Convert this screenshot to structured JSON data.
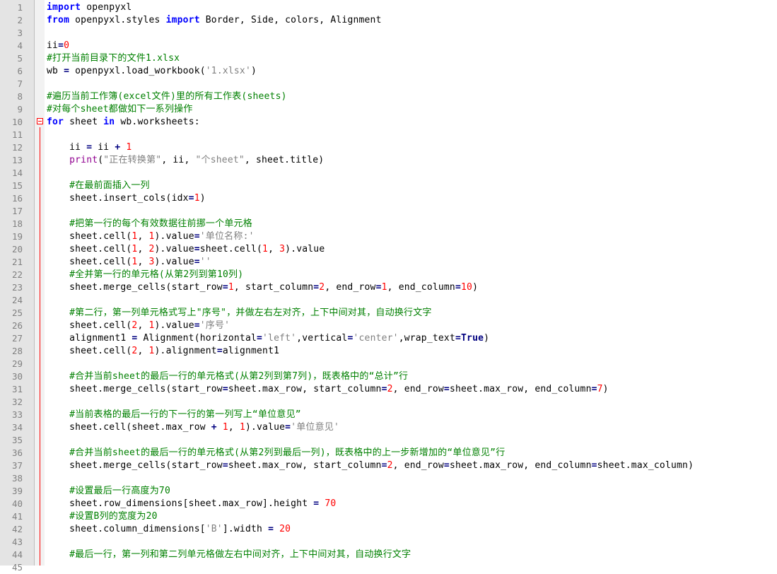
{
  "editor": {
    "language": "python",
    "syntax_colors": {
      "keyword": "#0000ff",
      "number": "#ff0000",
      "string": "#808080",
      "comment": "#008000",
      "builtin": "#900090",
      "operator": "#000080",
      "fold_marker": "#ff0000",
      "gutter_background": "#e4e4e4"
    },
    "fold_open_icon": "minus-box-icon",
    "lines": [
      {
        "n": "1",
        "tokens": [
          [
            "kw",
            "import"
          ],
          [
            "t",
            " openpyxl"
          ]
        ]
      },
      {
        "n": "2",
        "tokens": [
          [
            "kw",
            "from"
          ],
          [
            "t",
            " openpyxl.styles "
          ],
          [
            "kw",
            "import"
          ],
          [
            "t",
            " Border, Side, colors, Alignment"
          ]
        ]
      },
      {
        "n": "3",
        "tokens": []
      },
      {
        "n": "4",
        "tokens": [
          [
            "t",
            "ii"
          ],
          [
            "op",
            "="
          ],
          [
            "num",
            "0"
          ]
        ]
      },
      {
        "n": "5",
        "tokens": [
          [
            "cm",
            "#打开当前目录下的文件1.xlsx"
          ]
        ]
      },
      {
        "n": "6",
        "tokens": [
          [
            "t",
            "wb "
          ],
          [
            "op",
            "="
          ],
          [
            "t",
            " openpyxl.load_workbook("
          ],
          [
            "str",
            "'1.xlsx'"
          ],
          [
            "t",
            ")"
          ]
        ]
      },
      {
        "n": "7",
        "tokens": []
      },
      {
        "n": "8",
        "tokens": [
          [
            "cm",
            "#遍历当前工作簿(excel文件)里的所有工作表(sheets)"
          ]
        ]
      },
      {
        "n": "9",
        "tokens": [
          [
            "cm",
            "#对每个sheet都做如下一系列操作"
          ]
        ]
      },
      {
        "n": "10",
        "tokens": [
          [
            "kw",
            "for"
          ],
          [
            "t",
            " sheet "
          ],
          [
            "kw",
            "in"
          ],
          [
            "t",
            " wb.worksheets:"
          ]
        ]
      },
      {
        "n": "11",
        "tokens": []
      },
      {
        "n": "12",
        "tokens": [
          [
            "t",
            "    ii "
          ],
          [
            "op",
            "="
          ],
          [
            "t",
            " ii "
          ],
          [
            "op",
            "+"
          ],
          [
            "t",
            " "
          ],
          [
            "num",
            "1"
          ]
        ]
      },
      {
        "n": "13",
        "tokens": [
          [
            "t",
            "    "
          ],
          [
            "bi",
            "print"
          ],
          [
            "t",
            "("
          ],
          [
            "str",
            "\"正在转换第\""
          ],
          [
            "t",
            ", ii, "
          ],
          [
            "str",
            "\"个sheet\""
          ],
          [
            "t",
            ", sheet.title)"
          ]
        ]
      },
      {
        "n": "14",
        "tokens": []
      },
      {
        "n": "15",
        "tokens": [
          [
            "t",
            "    "
          ],
          [
            "cm",
            "#在最前面插入一列"
          ]
        ]
      },
      {
        "n": "16",
        "tokens": [
          [
            "t",
            "    sheet.insert_cols(idx"
          ],
          [
            "op",
            "="
          ],
          [
            "num",
            "1"
          ],
          [
            "t",
            ")"
          ]
        ]
      },
      {
        "n": "17",
        "tokens": []
      },
      {
        "n": "18",
        "tokens": [
          [
            "t",
            "    "
          ],
          [
            "cm",
            "#把第一行的每个有效数据往前挪一个单元格"
          ]
        ]
      },
      {
        "n": "19",
        "tokens": [
          [
            "t",
            "    sheet.cell("
          ],
          [
            "num",
            "1"
          ],
          [
            "t",
            ", "
          ],
          [
            "num",
            "1"
          ],
          [
            "t",
            ").value"
          ],
          [
            "op",
            "="
          ],
          [
            "str",
            "'单位名称:'"
          ]
        ]
      },
      {
        "n": "20",
        "tokens": [
          [
            "t",
            "    sheet.cell("
          ],
          [
            "num",
            "1"
          ],
          [
            "t",
            ", "
          ],
          [
            "num",
            "2"
          ],
          [
            "t",
            ").value"
          ],
          [
            "op",
            "="
          ],
          [
            "t",
            "sheet.cell("
          ],
          [
            "num",
            "1"
          ],
          [
            "t",
            ", "
          ],
          [
            "num",
            "3"
          ],
          [
            "t",
            ").value"
          ]
        ]
      },
      {
        "n": "21",
        "tokens": [
          [
            "t",
            "    sheet.cell("
          ],
          [
            "num",
            "1"
          ],
          [
            "t",
            ", "
          ],
          [
            "num",
            "3"
          ],
          [
            "t",
            ").value"
          ],
          [
            "op",
            "="
          ],
          [
            "str",
            "''"
          ]
        ]
      },
      {
        "n": "22",
        "tokens": [
          [
            "t",
            "    "
          ],
          [
            "cm",
            "#全并第一行的单元格(从第2列到第10列)"
          ]
        ]
      },
      {
        "n": "23",
        "tokens": [
          [
            "t",
            "    sheet.merge_cells(start_row"
          ],
          [
            "op",
            "="
          ],
          [
            "num",
            "1"
          ],
          [
            "t",
            ", start_column"
          ],
          [
            "op",
            "="
          ],
          [
            "num",
            "2"
          ],
          [
            "t",
            ", end_row"
          ],
          [
            "op",
            "="
          ],
          [
            "num",
            "1"
          ],
          [
            "t",
            ", end_column"
          ],
          [
            "op",
            "="
          ],
          [
            "num",
            "10"
          ],
          [
            "t",
            ")"
          ]
        ]
      },
      {
        "n": "24",
        "tokens": []
      },
      {
        "n": "25",
        "tokens": [
          [
            "t",
            "    "
          ],
          [
            "cm",
            "#第二行，第一列单元格式写上\"序号\"，并做左右左对齐，上下中间对其，自动换行文字"
          ]
        ]
      },
      {
        "n": "26",
        "tokens": [
          [
            "t",
            "    sheet.cell("
          ],
          [
            "num",
            "2"
          ],
          [
            "t",
            ", "
          ],
          [
            "num",
            "1"
          ],
          [
            "t",
            ").value"
          ],
          [
            "op",
            "="
          ],
          [
            "str",
            "'序号'"
          ]
        ]
      },
      {
        "n": "27",
        "tokens": [
          [
            "t",
            "    alignment1 "
          ],
          [
            "op",
            "="
          ],
          [
            "t",
            " Alignment(horizontal"
          ],
          [
            "op",
            "="
          ],
          [
            "str",
            "'left'"
          ],
          [
            "t",
            ",vertical"
          ],
          [
            "op",
            "="
          ],
          [
            "str",
            "'center'"
          ],
          [
            "t",
            ",wrap_text"
          ],
          [
            "op",
            "="
          ],
          [
            "ct",
            "True"
          ],
          [
            "t",
            ")"
          ]
        ]
      },
      {
        "n": "28",
        "tokens": [
          [
            "t",
            "    sheet.cell("
          ],
          [
            "num",
            "2"
          ],
          [
            "t",
            ", "
          ],
          [
            "num",
            "1"
          ],
          [
            "t",
            ").alignment"
          ],
          [
            "op",
            "="
          ],
          [
            "t",
            "alignment1"
          ]
        ]
      },
      {
        "n": "29",
        "tokens": []
      },
      {
        "n": "30",
        "tokens": [
          [
            "t",
            "    "
          ],
          [
            "cm",
            "#合并当前sheet的最后一行的单元格式(从第2列到第7列)，既表格中的“总计”行"
          ]
        ]
      },
      {
        "n": "31",
        "tokens": [
          [
            "t",
            "    sheet.merge_cells(start_row"
          ],
          [
            "op",
            "="
          ],
          [
            "t",
            "sheet.max_row, start_column"
          ],
          [
            "op",
            "="
          ],
          [
            "num",
            "2"
          ],
          [
            "t",
            ", end_row"
          ],
          [
            "op",
            "="
          ],
          [
            "t",
            "sheet.max_row, end_column"
          ],
          [
            "op",
            "="
          ],
          [
            "num",
            "7"
          ],
          [
            "t",
            ")"
          ]
        ]
      },
      {
        "n": "32",
        "tokens": []
      },
      {
        "n": "33",
        "tokens": [
          [
            "t",
            "    "
          ],
          [
            "cm",
            "#当前表格的最后一行的下一行的第一列写上“单位意见”"
          ]
        ]
      },
      {
        "n": "34",
        "tokens": [
          [
            "t",
            "    sheet.cell(sheet.max_row "
          ],
          [
            "op",
            "+"
          ],
          [
            "t",
            " "
          ],
          [
            "num",
            "1"
          ],
          [
            "t",
            ", "
          ],
          [
            "num",
            "1"
          ],
          [
            "t",
            ").value"
          ],
          [
            "op",
            "="
          ],
          [
            "str",
            "'单位意见'"
          ]
        ]
      },
      {
        "n": "35",
        "tokens": []
      },
      {
        "n": "36",
        "tokens": [
          [
            "t",
            "    "
          ],
          [
            "cm",
            "#合并当前sheet的最后一行的单元格式(从第2列到最后一列)，既表格中的上一步新增加的“单位意见”行"
          ]
        ]
      },
      {
        "n": "37",
        "tokens": [
          [
            "t",
            "    sheet.merge_cells(start_row"
          ],
          [
            "op",
            "="
          ],
          [
            "t",
            "sheet.max_row, start_column"
          ],
          [
            "op",
            "="
          ],
          [
            "num",
            "2"
          ],
          [
            "t",
            ", end_row"
          ],
          [
            "op",
            "="
          ],
          [
            "t",
            "sheet.max_row, end_column"
          ],
          [
            "op",
            "="
          ],
          [
            "t",
            "sheet.max_column)"
          ]
        ]
      },
      {
        "n": "38",
        "tokens": []
      },
      {
        "n": "39",
        "tokens": [
          [
            "t",
            "    "
          ],
          [
            "cm",
            "#设置最后一行高度为70"
          ]
        ]
      },
      {
        "n": "40",
        "tokens": [
          [
            "t",
            "    sheet.row_dimensions[sheet.max_row].height "
          ],
          [
            "op",
            "="
          ],
          [
            "t",
            " "
          ],
          [
            "num",
            "70"
          ]
        ]
      },
      {
        "n": "41",
        "tokens": [
          [
            "t",
            "    "
          ],
          [
            "cm",
            "#设置B列的宽度为20"
          ]
        ]
      },
      {
        "n": "42",
        "tokens": [
          [
            "t",
            "    sheet.column_dimensions["
          ],
          [
            "str",
            "'B'"
          ],
          [
            "t",
            "].width "
          ],
          [
            "op",
            "="
          ],
          [
            "t",
            " "
          ],
          [
            "num",
            "20"
          ]
        ]
      },
      {
        "n": "43",
        "tokens": []
      },
      {
        "n": "44",
        "tokens": [
          [
            "t",
            "    "
          ],
          [
            "cm",
            "#最后一行，第一列和第二列单元格做左右中间对齐，上下中间对其，自动换行文字"
          ]
        ]
      },
      {
        "n": "45",
        "tokens": []
      }
    ]
  }
}
